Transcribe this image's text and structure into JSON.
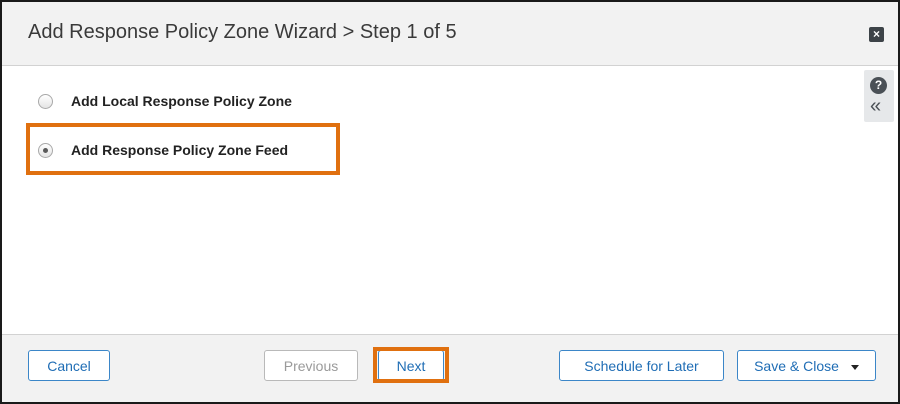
{
  "dialog": {
    "title": "Add Response Policy Zone Wizard > Step 1 of 5",
    "close_icon": "close-icon",
    "help_icon": "help-icon",
    "collapse_icon": "double-chevron-left-icon"
  },
  "options": [
    {
      "label": "Add Local Response Policy Zone",
      "selected": false
    },
    {
      "label": "Add Response Policy Zone Feed",
      "selected": true
    }
  ],
  "footer": {
    "cancel_label": "Cancel",
    "previous_label": "Previous",
    "next_label": "Next",
    "schedule_label": "Schedule for Later",
    "save_close_label": "Save & Close"
  },
  "colors": {
    "highlight": "#e0700f",
    "button_text": "#1f6db5",
    "button_border": "#3b86c8"
  }
}
